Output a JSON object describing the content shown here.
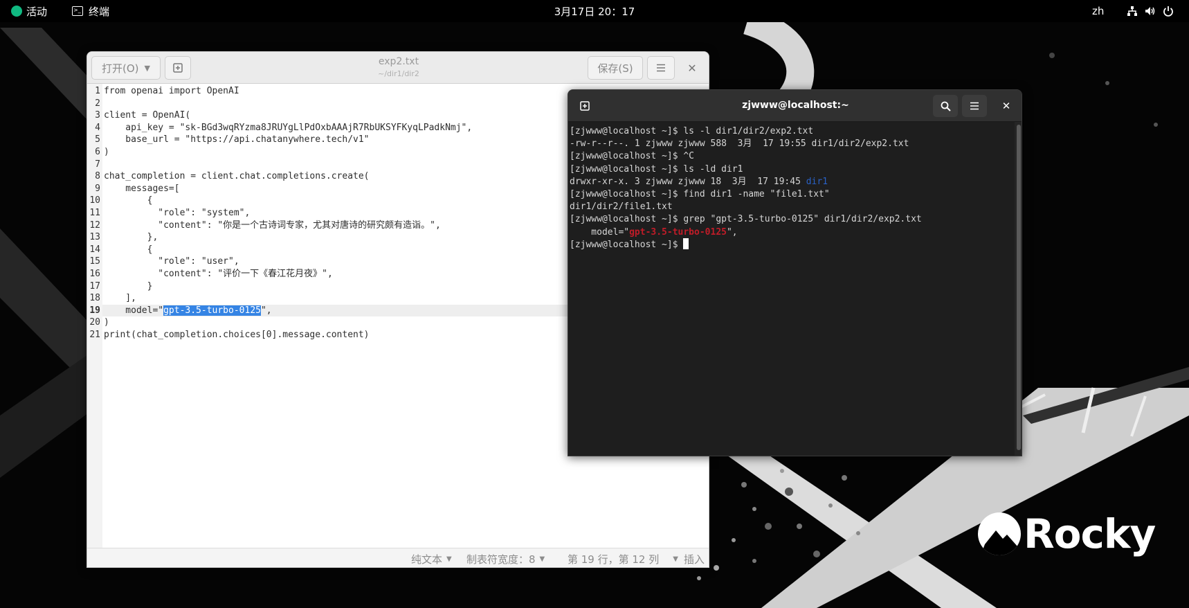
{
  "topbar": {
    "activities": "活动",
    "app_name": "终端",
    "clock": "3月17日 20：17",
    "language": "zh",
    "icons": [
      "network-icon",
      "volume-icon",
      "power-icon"
    ]
  },
  "gedit": {
    "open_label": "打开(O)",
    "save_label": "保存(S)",
    "title": "exp2.txt",
    "subtitle": "~/dir1/dir2",
    "lines": [
      "from openai import OpenAI",
      "",
      "client = OpenAI(",
      "    api_key = \"sk-BGd3wqRYzma8JRUYgLlPdOxbAAAjR7RbUKSYFKyqLPadkNmj\",",
      "    base_url = \"https://api.chatanywhere.tech/v1\"",
      ")",
      "",
      "chat_completion = client.chat.completions.create(",
      "    messages=[",
      "        {",
      "          \"role\": \"system\",",
      "          \"content\": \"你是一个古诗词专家，尤其对唐诗的研究颇有造诣。\",",
      "        },",
      "        {",
      "          \"role\": \"user\",",
      "          \"content\": \"评价一下《春江花月夜》\",",
      "        }",
      "    ],",
      "    model=\"gpt-3.5-turbo-0125\",",
      ")",
      "print(chat_completion.choices[0].message.content)"
    ],
    "line19_prefix": "    model=\"",
    "line19_selected": "gpt-3.5-turbo-0125",
    "line19_suffix": "\",",
    "current_line": 19,
    "status": {
      "syntax": "纯文本",
      "tab_width": "制表符宽度：8",
      "position": "第 19 行，第 12 列",
      "mode": "插入"
    }
  },
  "terminal": {
    "title": "zjwww@localhost:~",
    "lines": [
      {
        "text": "[zjwww@localhost ~]$ ls -l dir1/dir2/exp2.txt"
      },
      {
        "text": "-rw-r--r--. 1 zjwww zjwww 588  3月  17 19:55 dir1/dir2/exp2.txt"
      },
      {
        "text": "[zjwww@localhost ~]$ ^C"
      },
      {
        "text": "[zjwww@localhost ~]$ ls -ld dir1"
      },
      {
        "text": "drwxr-xr-x. 3 zjwww zjwww 18  3月  17 19:45 ",
        "dir": "dir1"
      },
      {
        "text": "[zjwww@localhost ~]$ find dir1 -name \"file1.txt\""
      },
      {
        "text": "dir1/dir2/file1.txt"
      },
      {
        "text": "[zjwww@localhost ~]$ grep \"gpt-3.5-turbo-0125\" dir1/dir2/exp2.txt"
      },
      {
        "text": "    model=\"",
        "match": "gpt-3.5-turbo-0125",
        "after": "\","
      },
      {
        "text": "[zjwww@localhost ~]$ ",
        "cursor": true
      }
    ]
  },
  "wallpaper": {
    "brand": "Rocky"
  }
}
